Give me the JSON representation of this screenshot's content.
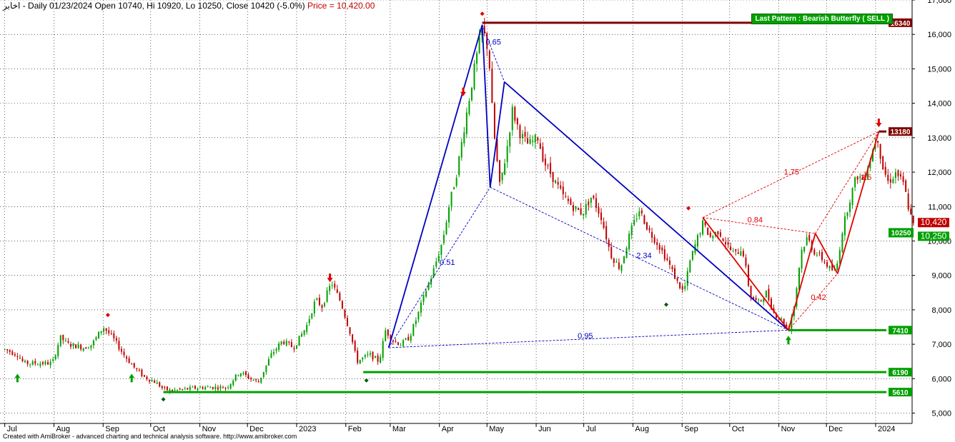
{
  "header": {
    "symbol": "اخابر",
    "text": "- Daily 01/23/2024 Open 10740, Hi 10920, Lo 10250, Close 10420 (-5.0%)",
    "price_text": "Price = 10,420.00"
  },
  "footer_text": "Created with AmiBroker - advanced charting and technical analysis software. http://www.amibroker.com",
  "pattern_badge": "Last Pattern : Bearish Butterfly ( SELL )",
  "colors": {
    "up": "#00a000",
    "down": "#c00000",
    "bull_pattern": "#0000c0",
    "bear_pattern": "#e00000",
    "resistance": "#800000",
    "support": "#00a000",
    "grid": "#000000"
  },
  "chart_data": {
    "type": "line",
    "title": "",
    "ylim": [
      4700,
      17000
    ],
    "y_ticks": [
      5000,
      6000,
      7000,
      8000,
      9000,
      10000,
      11000,
      12000,
      13000,
      14000,
      15000,
      16000,
      17000
    ],
    "y_tick_labels": [
      "5,000",
      "6,000",
      "7,000",
      "8,000",
      "9,000",
      "10,000",
      "11,000",
      "12,000",
      "13,000",
      "14,000",
      "15,000",
      "16,000",
      "17,000"
    ],
    "x_labels": [
      "Jul",
      "Aug",
      "Sep",
      "Oct",
      "Nov",
      "Dec",
      "2023",
      "Feb",
      "Mar",
      "Apr",
      "May",
      "Jun",
      "Jul",
      "Aug",
      "Sep",
      "Oct",
      "Nov",
      "Dec",
      "2024"
    ],
    "x_label_days": [
      0,
      31,
      62,
      92,
      123,
      153,
      184,
      215,
      243,
      274,
      304,
      335,
      365,
      396,
      427,
      457,
      488,
      518,
      549
    ],
    "x_days_range": [
      -3,
      572
    ],
    "price_path": [
      [
        0,
        6850
      ],
      [
        8,
        6700
      ],
      [
        12,
        6450
      ],
      [
        20,
        6450
      ],
      [
        30,
        6450
      ],
      [
        35,
        7200
      ],
      [
        40,
        7000
      ],
      [
        50,
        6900
      ],
      [
        55,
        7000
      ],
      [
        62,
        7500
      ],
      [
        68,
        7200
      ],
      [
        75,
        6700
      ],
      [
        82,
        6300
      ],
      [
        88,
        6050
      ],
      [
        95,
        5900
      ],
      [
        100,
        5700
      ],
      [
        105,
        5650
      ],
      [
        115,
        5700
      ],
      [
        125,
        5750
      ],
      [
        140,
        5750
      ],
      [
        148,
        6200
      ],
      [
        155,
        6000
      ],
      [
        160,
        5900
      ],
      [
        168,
        6700
      ],
      [
        175,
        7100
      ],
      [
        182,
        6900
      ],
      [
        190,
        7500
      ],
      [
        196,
        8300
      ],
      [
        200,
        8100
      ],
      [
        206,
        8800
      ],
      [
        212,
        8200
      ],
      [
        218,
        7300
      ],
      [
        222,
        6500
      ],
      [
        230,
        6700
      ],
      [
        236,
        6500
      ],
      [
        240,
        7400
      ],
      [
        245,
        7100
      ],
      [
        250,
        7000
      ],
      [
        255,
        7200
      ],
      [
        260,
        7800
      ],
      [
        265,
        8500
      ],
      [
        270,
        9100
      ],
      [
        276,
        10000
      ],
      [
        280,
        11000
      ],
      [
        285,
        12000
      ],
      [
        290,
        13400
      ],
      [
        296,
        15000
      ],
      [
        301,
        16200
      ],
      [
        305,
        15500
      ],
      [
        308,
        13300
      ],
      [
        312,
        11600
      ],
      [
        316,
        12500
      ],
      [
        320,
        13800
      ],
      [
        325,
        13100
      ],
      [
        330,
        12800
      ],
      [
        336,
        13000
      ],
      [
        340,
        12300
      ],
      [
        346,
        11800
      ],
      [
        352,
        11300
      ],
      [
        358,
        11000
      ],
      [
        364,
        10800
      ],
      [
        370,
        11300
      ],
      [
        376,
        10700
      ],
      [
        382,
        9600
      ],
      [
        388,
        9200
      ],
      [
        394,
        10200
      ],
      [
        400,
        10900
      ],
      [
        406,
        10300
      ],
      [
        412,
        9900
      ],
      [
        418,
        9400
      ],
      [
        424,
        8800
      ],
      [
        428,
        8500
      ],
      [
        432,
        9400
      ],
      [
        436,
        10000
      ],
      [
        440,
        10500
      ],
      [
        445,
        10100
      ],
      [
        450,
        10300
      ],
      [
        455,
        9900
      ],
      [
        460,
        9600
      ],
      [
        465,
        9800
      ],
      [
        470,
        8400
      ],
      [
        475,
        8200
      ],
      [
        480,
        8500
      ],
      [
        485,
        7900
      ],
      [
        490,
        7700
      ],
      [
        494,
        7400
      ],
      [
        498,
        8200
      ],
      [
        502,
        9700
      ],
      [
        506,
        10100
      ],
      [
        510,
        9700
      ],
      [
        515,
        9500
      ],
      [
        520,
        9200
      ],
      [
        524,
        9100
      ],
      [
        528,
        10300
      ],
      [
        532,
        11100
      ],
      [
        537,
        11900
      ],
      [
        541,
        11800
      ],
      [
        545,
        12300
      ],
      [
        550,
        13100
      ],
      [
        553,
        12200
      ],
      [
        557,
        11700
      ],
      [
        562,
        12000
      ],
      [
        567,
        11600
      ],
      [
        570,
        10900
      ],
      [
        573,
        10420
      ]
    ],
    "bullish_butterfly": {
      "points": [
        [
          242,
          6900
        ],
        [
          301,
          16280
        ],
        [
          306,
          11560
        ],
        [
          315,
          14620
        ],
        [
          494,
          7410
        ]
      ],
      "ratios": [
        {
          "label": "0.65",
          "at": [
            308,
            15700
          ]
        },
        {
          "label": "0.51",
          "at": [
            279,
            9300
          ]
        },
        {
          "label": "2.34",
          "at": [
            403,
            9500
          ]
        },
        {
          "label": "0.95",
          "at": [
            366,
            7170
          ]
        }
      ]
    },
    "bearish_butterfly": {
      "points": [
        [
          440,
          10680
        ],
        [
          494,
          7410
        ],
        [
          511,
          10220
        ],
        [
          525,
          9050
        ],
        [
          551,
          13180
        ]
      ],
      "ratios": [
        {
          "label": "0.84",
          "at": [
            473,
            10540
          ]
        },
        {
          "label": "0.42",
          "at": [
            513,
            8290
          ]
        },
        {
          "label": "1.75",
          "at": [
            496,
            11930
          ]
        },
        {
          "label": "3.5",
          "at": [
            543,
            11770
          ]
        }
      ]
    },
    "levels": [
      {
        "value": 16340,
        "label": "16340",
        "from": 301,
        "kind": "resistance"
      },
      {
        "value": 13180,
        "label": "13180",
        "from": 551,
        "kind": "resistance"
      },
      {
        "value": 7410,
        "label": "7410",
        "from": 494,
        "kind": "support"
      },
      {
        "value": 6190,
        "label": "6190",
        "from": 226,
        "kind": "support"
      },
      {
        "value": 5610,
        "label": "5610",
        "from": 100,
        "kind": "support"
      }
    ],
    "price_tags": [
      {
        "value": 10420,
        "label": "10,420",
        "color": "#c00000"
      },
      {
        "value": 10250,
        "label": "10,250",
        "color": "#00a000"
      },
      {
        "value": 10250,
        "label": "10250",
        "color": "#00a000",
        "left": true
      }
    ],
    "signals": [
      {
        "day": 8,
        "price": 6000,
        "type": "buy-arrow"
      },
      {
        "day": 80,
        "price": 6000,
        "type": "buy-arrow"
      },
      {
        "day": 205,
        "price": 8950,
        "type": "sell-arrow"
      },
      {
        "day": 289,
        "price": 14350,
        "type": "sell-arrow"
      },
      {
        "day": 494,
        "price": 7100,
        "type": "buy-arrow"
      },
      {
        "day": 551,
        "price": 13450,
        "type": "sell-arrow"
      },
      {
        "day": 65,
        "price": 7850,
        "type": "top-diamond"
      },
      {
        "day": 301,
        "price": 16600,
        "type": "top-diamond"
      },
      {
        "day": 431,
        "price": 10950,
        "type": "top-diamond"
      },
      {
        "day": 100,
        "price": 5400,
        "type": "bottom-diamond"
      },
      {
        "day": 228,
        "price": 5950,
        "type": "bottom-diamond"
      },
      {
        "day": 417,
        "price": 8150,
        "type": "bottom-diamond"
      }
    ]
  }
}
